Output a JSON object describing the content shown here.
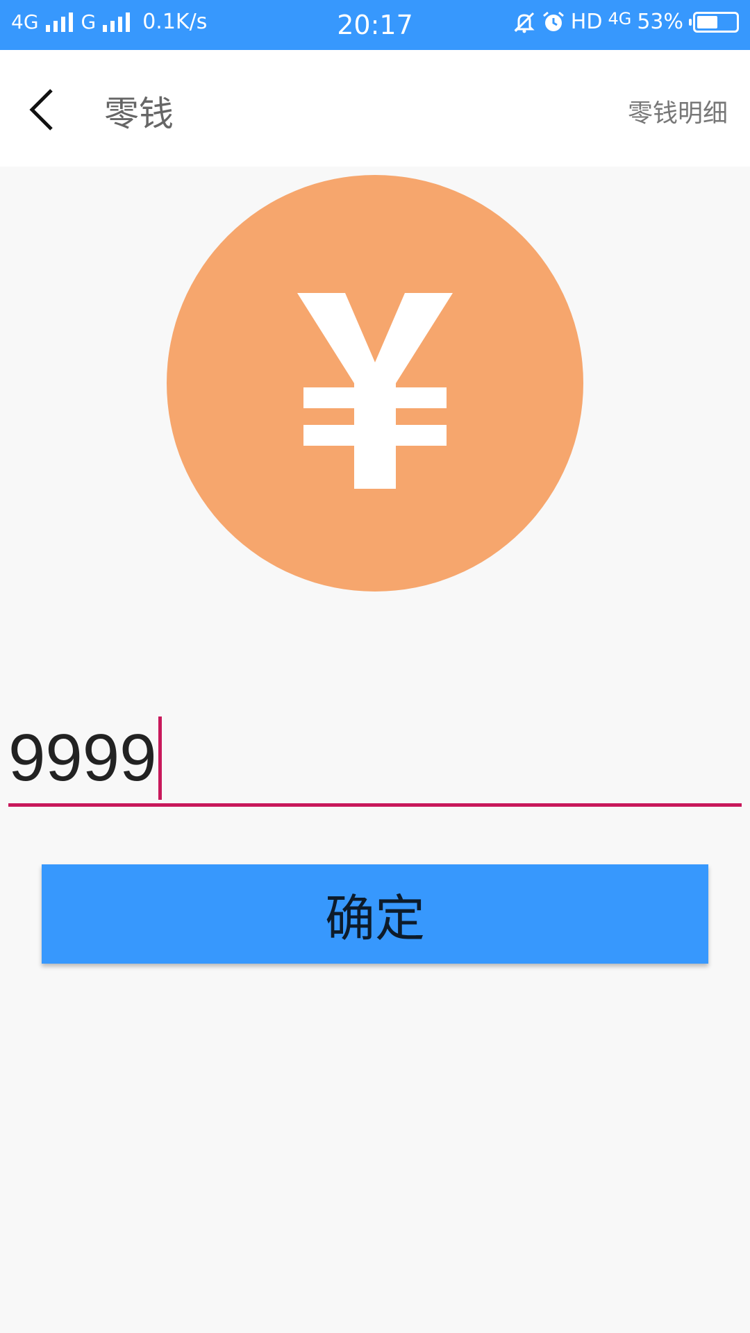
{
  "status_bar": {
    "network1": "4G",
    "network2": "G",
    "speed": "0.1K/s",
    "time": "20:17",
    "hd": "HD",
    "network3": "4G",
    "battery_percent": "53%",
    "battery_level": 0.53,
    "icons": [
      "signal-icon",
      "mute-bell-icon",
      "alarm-icon",
      "battery-icon"
    ]
  },
  "header": {
    "back_icon": "chevron-left-icon",
    "title": "零钱",
    "detail_link": "零钱明细"
  },
  "coin": {
    "icon": "yen-icon",
    "color": "#f6a66d"
  },
  "amount_input": {
    "value": "9999",
    "accent": "#c8195b"
  },
  "confirm_button": {
    "label": "确定",
    "color": "#3798fd"
  },
  "colors": {
    "primary": "#3798fd",
    "background": "#f8f8f8"
  }
}
